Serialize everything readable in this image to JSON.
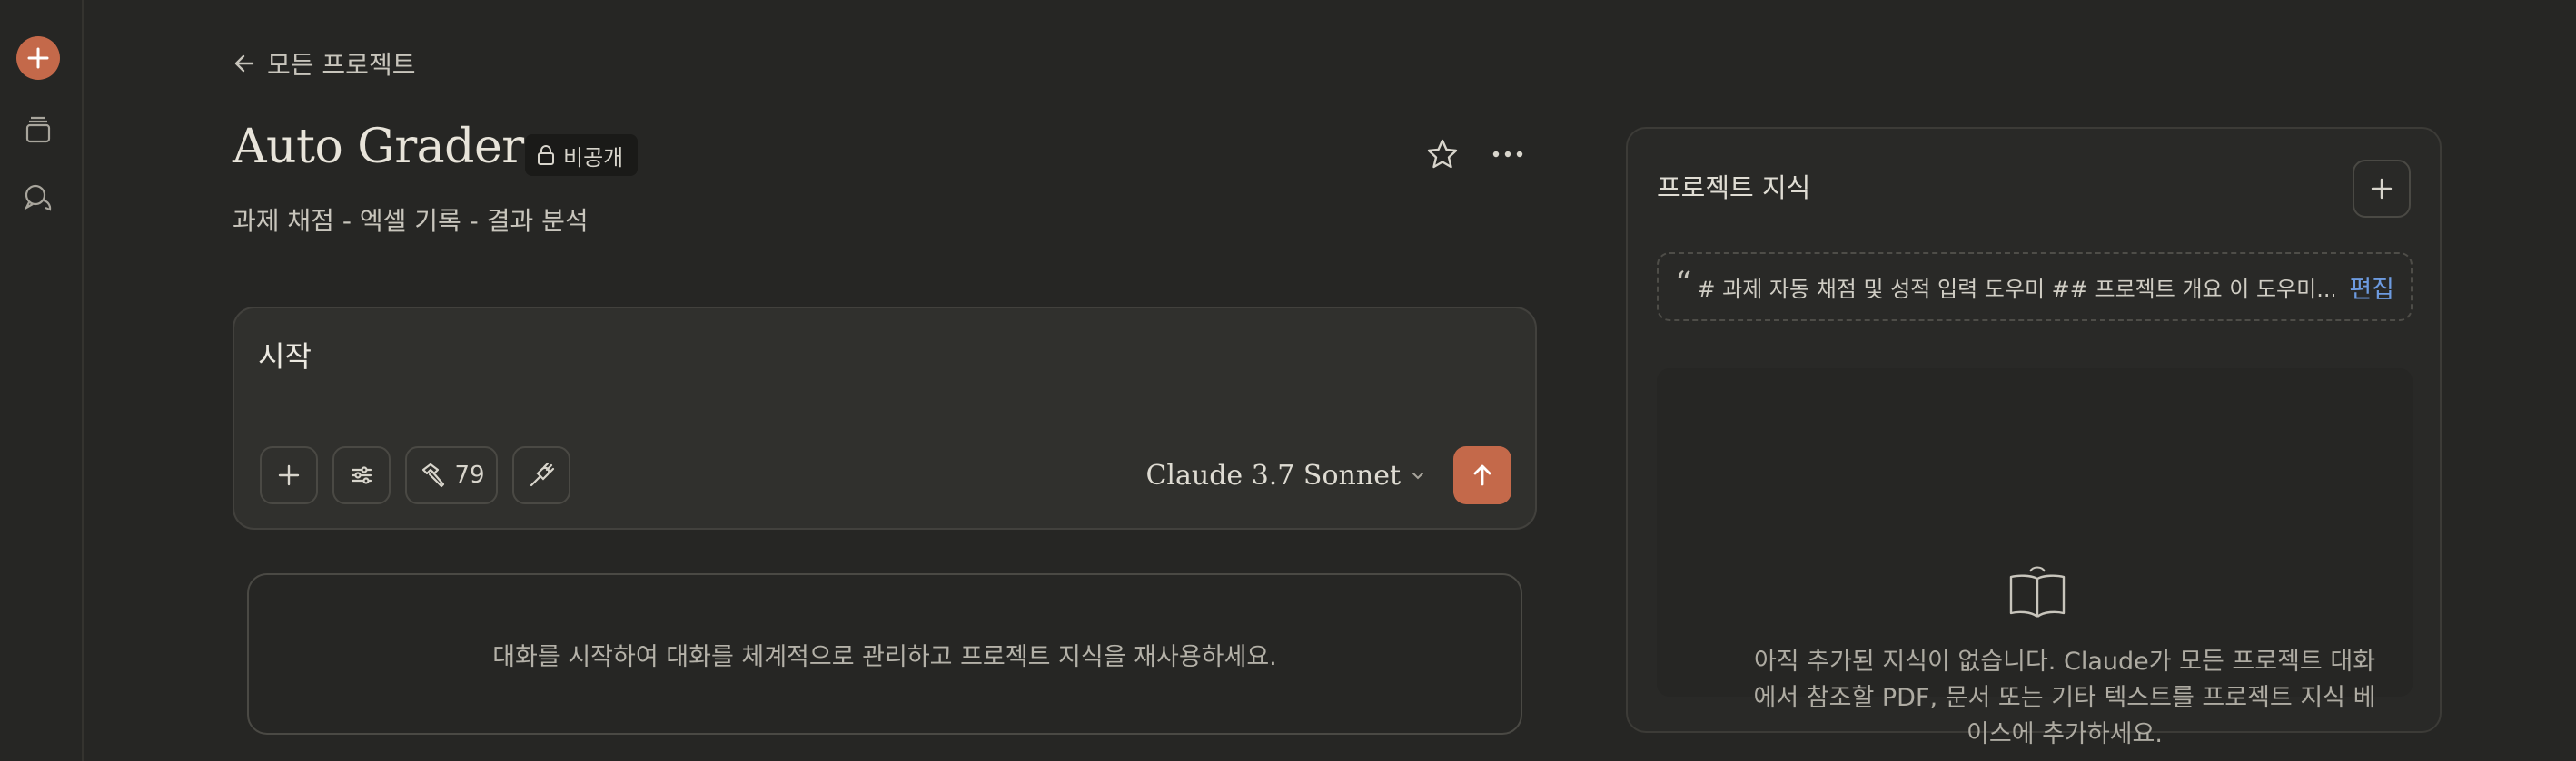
{
  "nav": {
    "back_label": "모든 프로젝트"
  },
  "project": {
    "title": "Auto Grader",
    "visibility": "비공개",
    "description": "과제 채점 - 엑셀 기록 - 결과 분석"
  },
  "composer": {
    "input_value": "시작",
    "tools_count": "79",
    "model": "Claude 3.7 Sonnet"
  },
  "chats": {
    "empty_text": "대화를 시작하여 대화를 체계적으로 관리하고 프로젝트 지식을 재사용하세요."
  },
  "knowledge": {
    "title": "프로젝트 지식",
    "instructions_preview": "# 과제 자동 채점 및 성적 입력 도우미 ## 프로젝트 개요 이 도우미...",
    "edit_label": "편집",
    "empty_line1": "아직 추가된 지식이 없습니다. Claude가 모든 프로젝트 대화",
    "empty_line2": "에서 참조할 PDF, 문서 또는 기타 텍스트를 프로젝트 지식 베",
    "empty_line3": "이스에 추가하세요."
  },
  "colors": {
    "accent": "#c4694a",
    "link": "#6d9be0",
    "background": "#262624"
  },
  "icons": [
    "plus-icon",
    "projects-icon",
    "chats-icon",
    "arrow-left-icon",
    "lock-icon",
    "star-icon",
    "more-icon",
    "sliders-icon",
    "hammer-icon",
    "plug-icon",
    "chevron-down-icon",
    "arrow-up-icon",
    "book-icon",
    "quote-icon"
  ]
}
